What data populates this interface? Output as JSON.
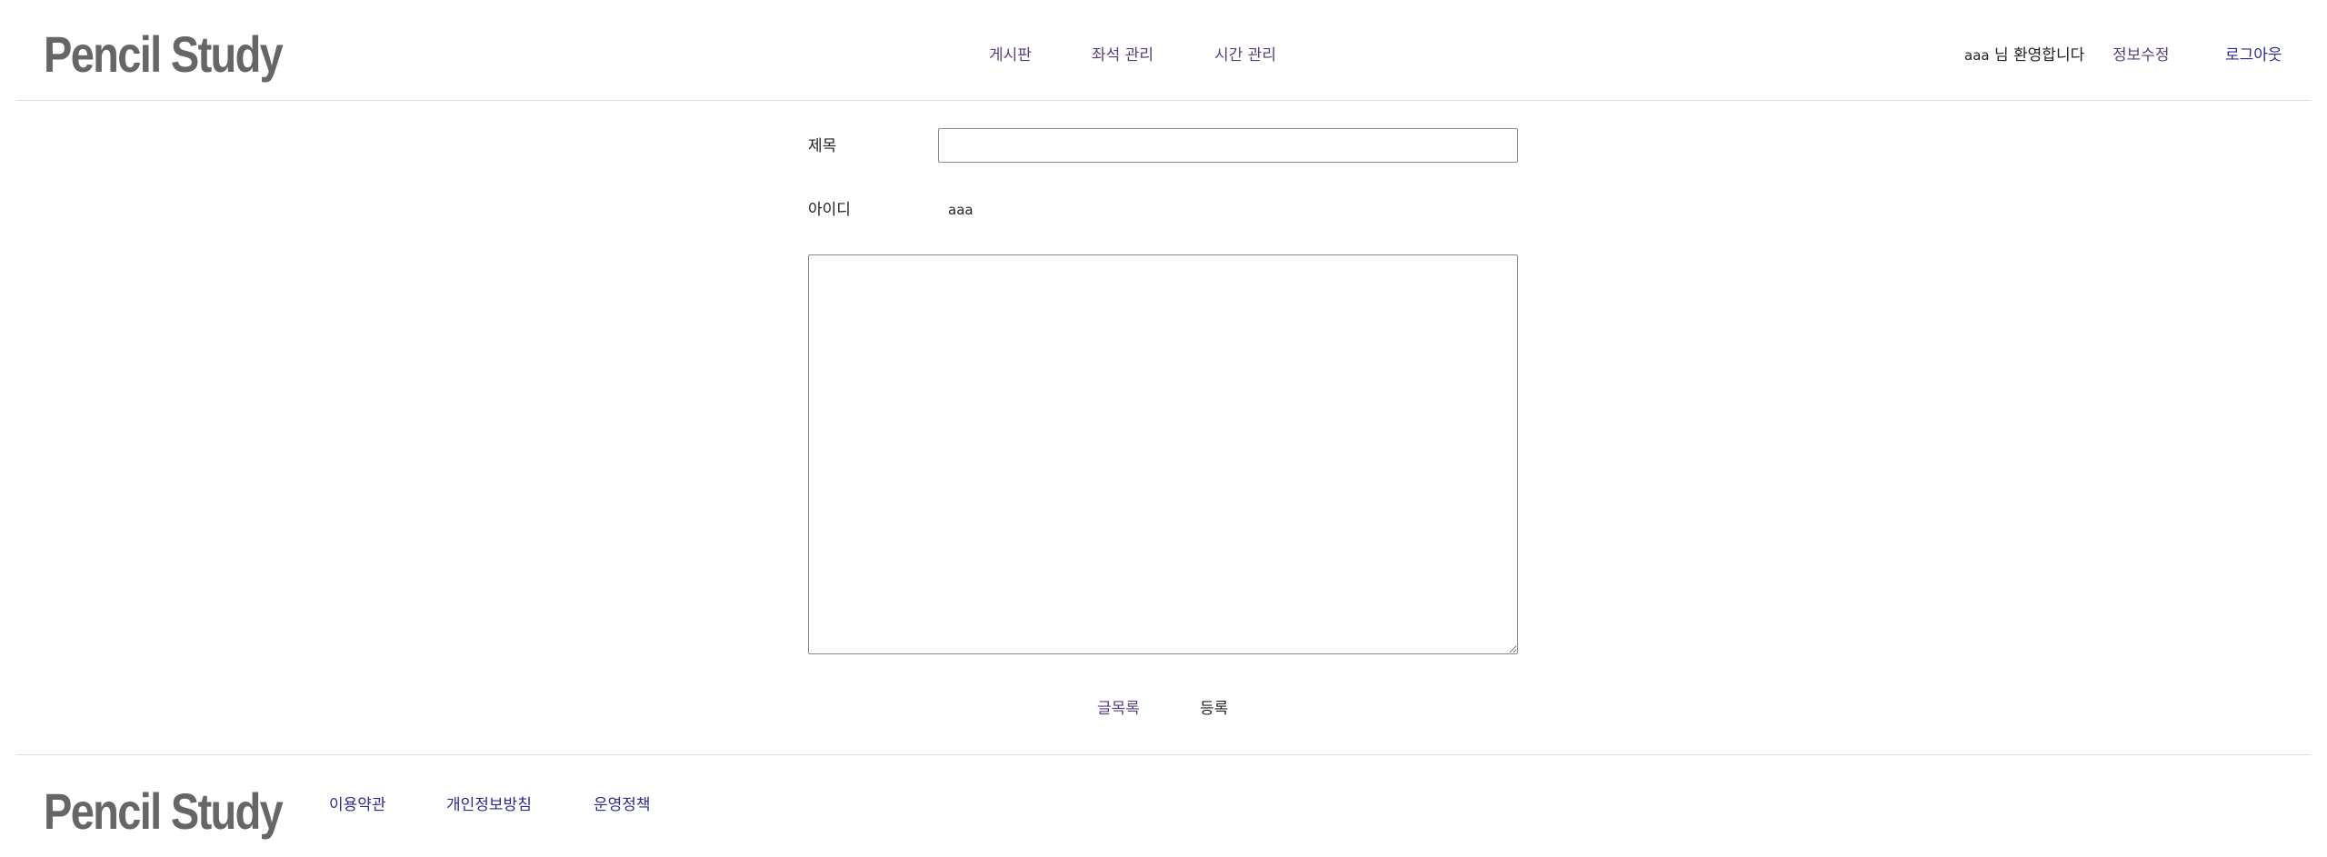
{
  "header": {
    "logo": "Pencil Study",
    "nav": {
      "board": "게시판",
      "seat_management": "좌석 관리",
      "time_management": "시간 관리"
    },
    "user": {
      "username": "aaa",
      "welcome_suffix": "님 환영합니다",
      "edit_profile": "정보수정",
      "logout": "로그아웃"
    }
  },
  "form": {
    "title_label": "제목",
    "title_value": "",
    "author_label": "아이디",
    "author_value": "aaa",
    "content_value": "",
    "list_button": "글목록",
    "submit_button": "등록"
  },
  "footer": {
    "logo": "Pencil Study",
    "links": {
      "terms": "이용약관",
      "privacy": "개인정보방침",
      "policy": "운영정책"
    }
  }
}
